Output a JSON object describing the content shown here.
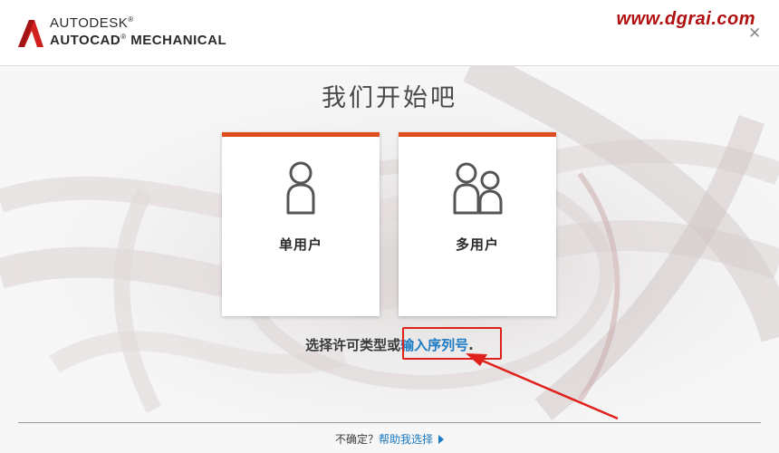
{
  "header": {
    "brand": "AUTODESK",
    "brand_mark": "®",
    "product": "AUTOCAD",
    "product_mark": "®",
    "product_suffix": " MECHANICAL",
    "watermark": "www.dgrai.com",
    "close_icon": "close-icon"
  },
  "main": {
    "title": "我们开始吧",
    "options": [
      {
        "label": "单用户",
        "icon": "single-user-icon"
      },
      {
        "label": "多用户",
        "icon": "multi-user-icon"
      }
    ],
    "license_prompt": "选择许可类型或",
    "serial_link": "输入序列号",
    "license_suffix": "."
  },
  "footer": {
    "unsure_text": "不确定？",
    "help_link": "帮助我选择",
    "help_icon": "play-triangle-icon"
  },
  "colors": {
    "accent": "#e04a1f",
    "link": "#1a7ac4",
    "annotation": "#e0201a",
    "watermark": "#b01010"
  }
}
